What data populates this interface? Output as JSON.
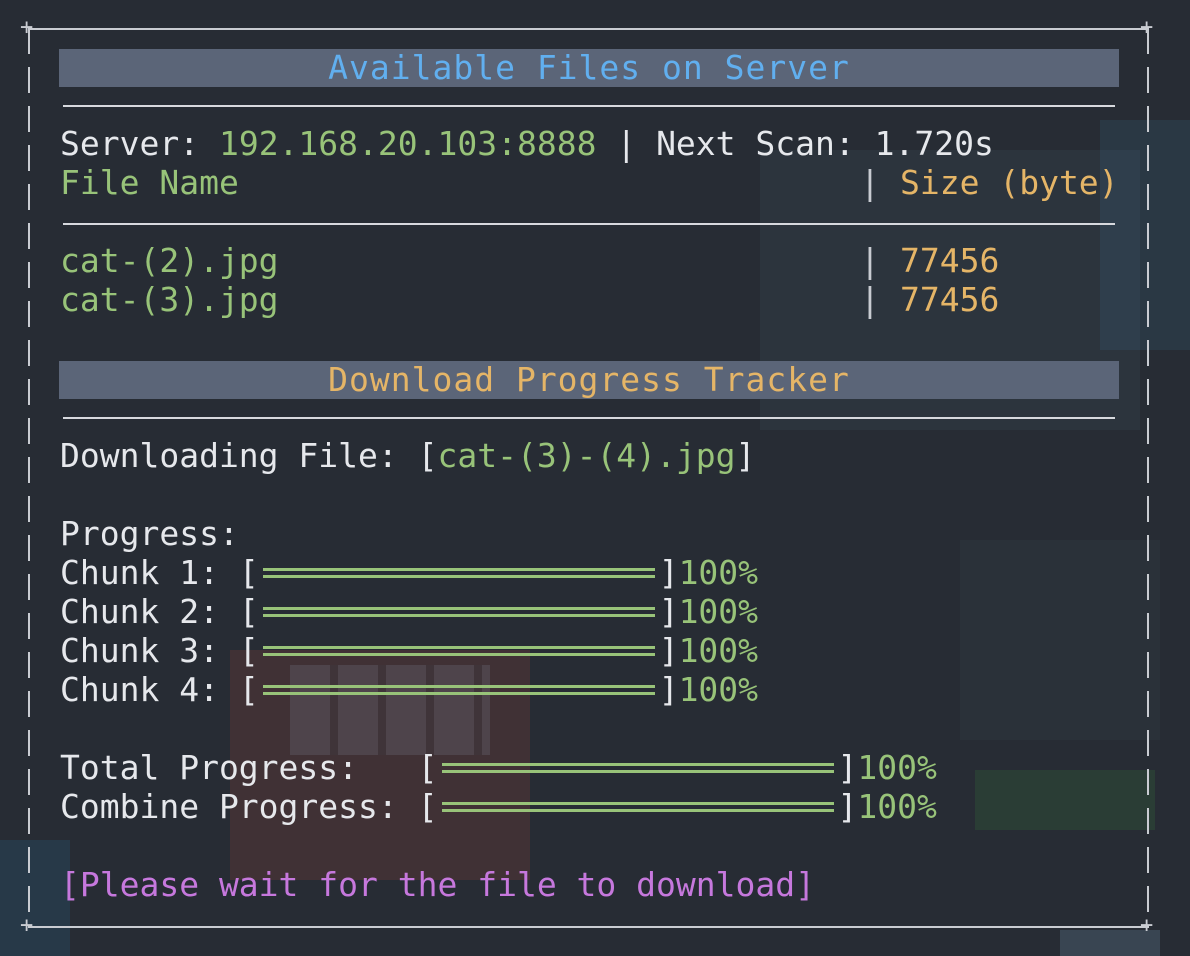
{
  "files_panel": {
    "title": "Available Files on Server",
    "server_label": "Server: ",
    "server_address": "192.168.20.103:8888",
    "separator": " | ",
    "next_scan_label": "Next Scan: ",
    "next_scan_value": "1.720s",
    "col_name_header": "File Name",
    "col_size_header": "Size (byte)",
    "files": [
      {
        "name": "cat-(2).jpg",
        "size": "77456"
      },
      {
        "name": "cat-(3).jpg",
        "size": "77456"
      }
    ]
  },
  "download_panel": {
    "title": "Download Progress Tracker",
    "downloading_label": "Downloading File: ",
    "open_bracket": "[",
    "close_bracket": "]",
    "downloading_file": "cat-(3)-(4).jpg",
    "progress_label": "Progress:",
    "chunks": [
      {
        "label": "Chunk 1: ",
        "percent_text": "100%",
        "progress": 1.0
      },
      {
        "label": "Chunk 2: ",
        "percent_text": "100%",
        "progress": 1.0
      },
      {
        "label": "Chunk 3: ",
        "percent_text": "100%",
        "progress": 1.0
      },
      {
        "label": "Chunk 4: ",
        "percent_text": "100%",
        "progress": 1.0
      }
    ],
    "total_label": "Total Progress:   ",
    "total_percent": "100%",
    "total_progress": 1.0,
    "combine_label": "Combine Progress: ",
    "combine_percent": "100%",
    "combine_progress": 1.0,
    "status_message": "[Please wait for the file to download]"
  },
  "colors": {
    "background": "#272c34",
    "accent_blue": "#61afef",
    "accent_green": "#98c379",
    "accent_orange": "#e5b567",
    "accent_purple": "#c678dd",
    "banner_bg": "#5b6578"
  }
}
